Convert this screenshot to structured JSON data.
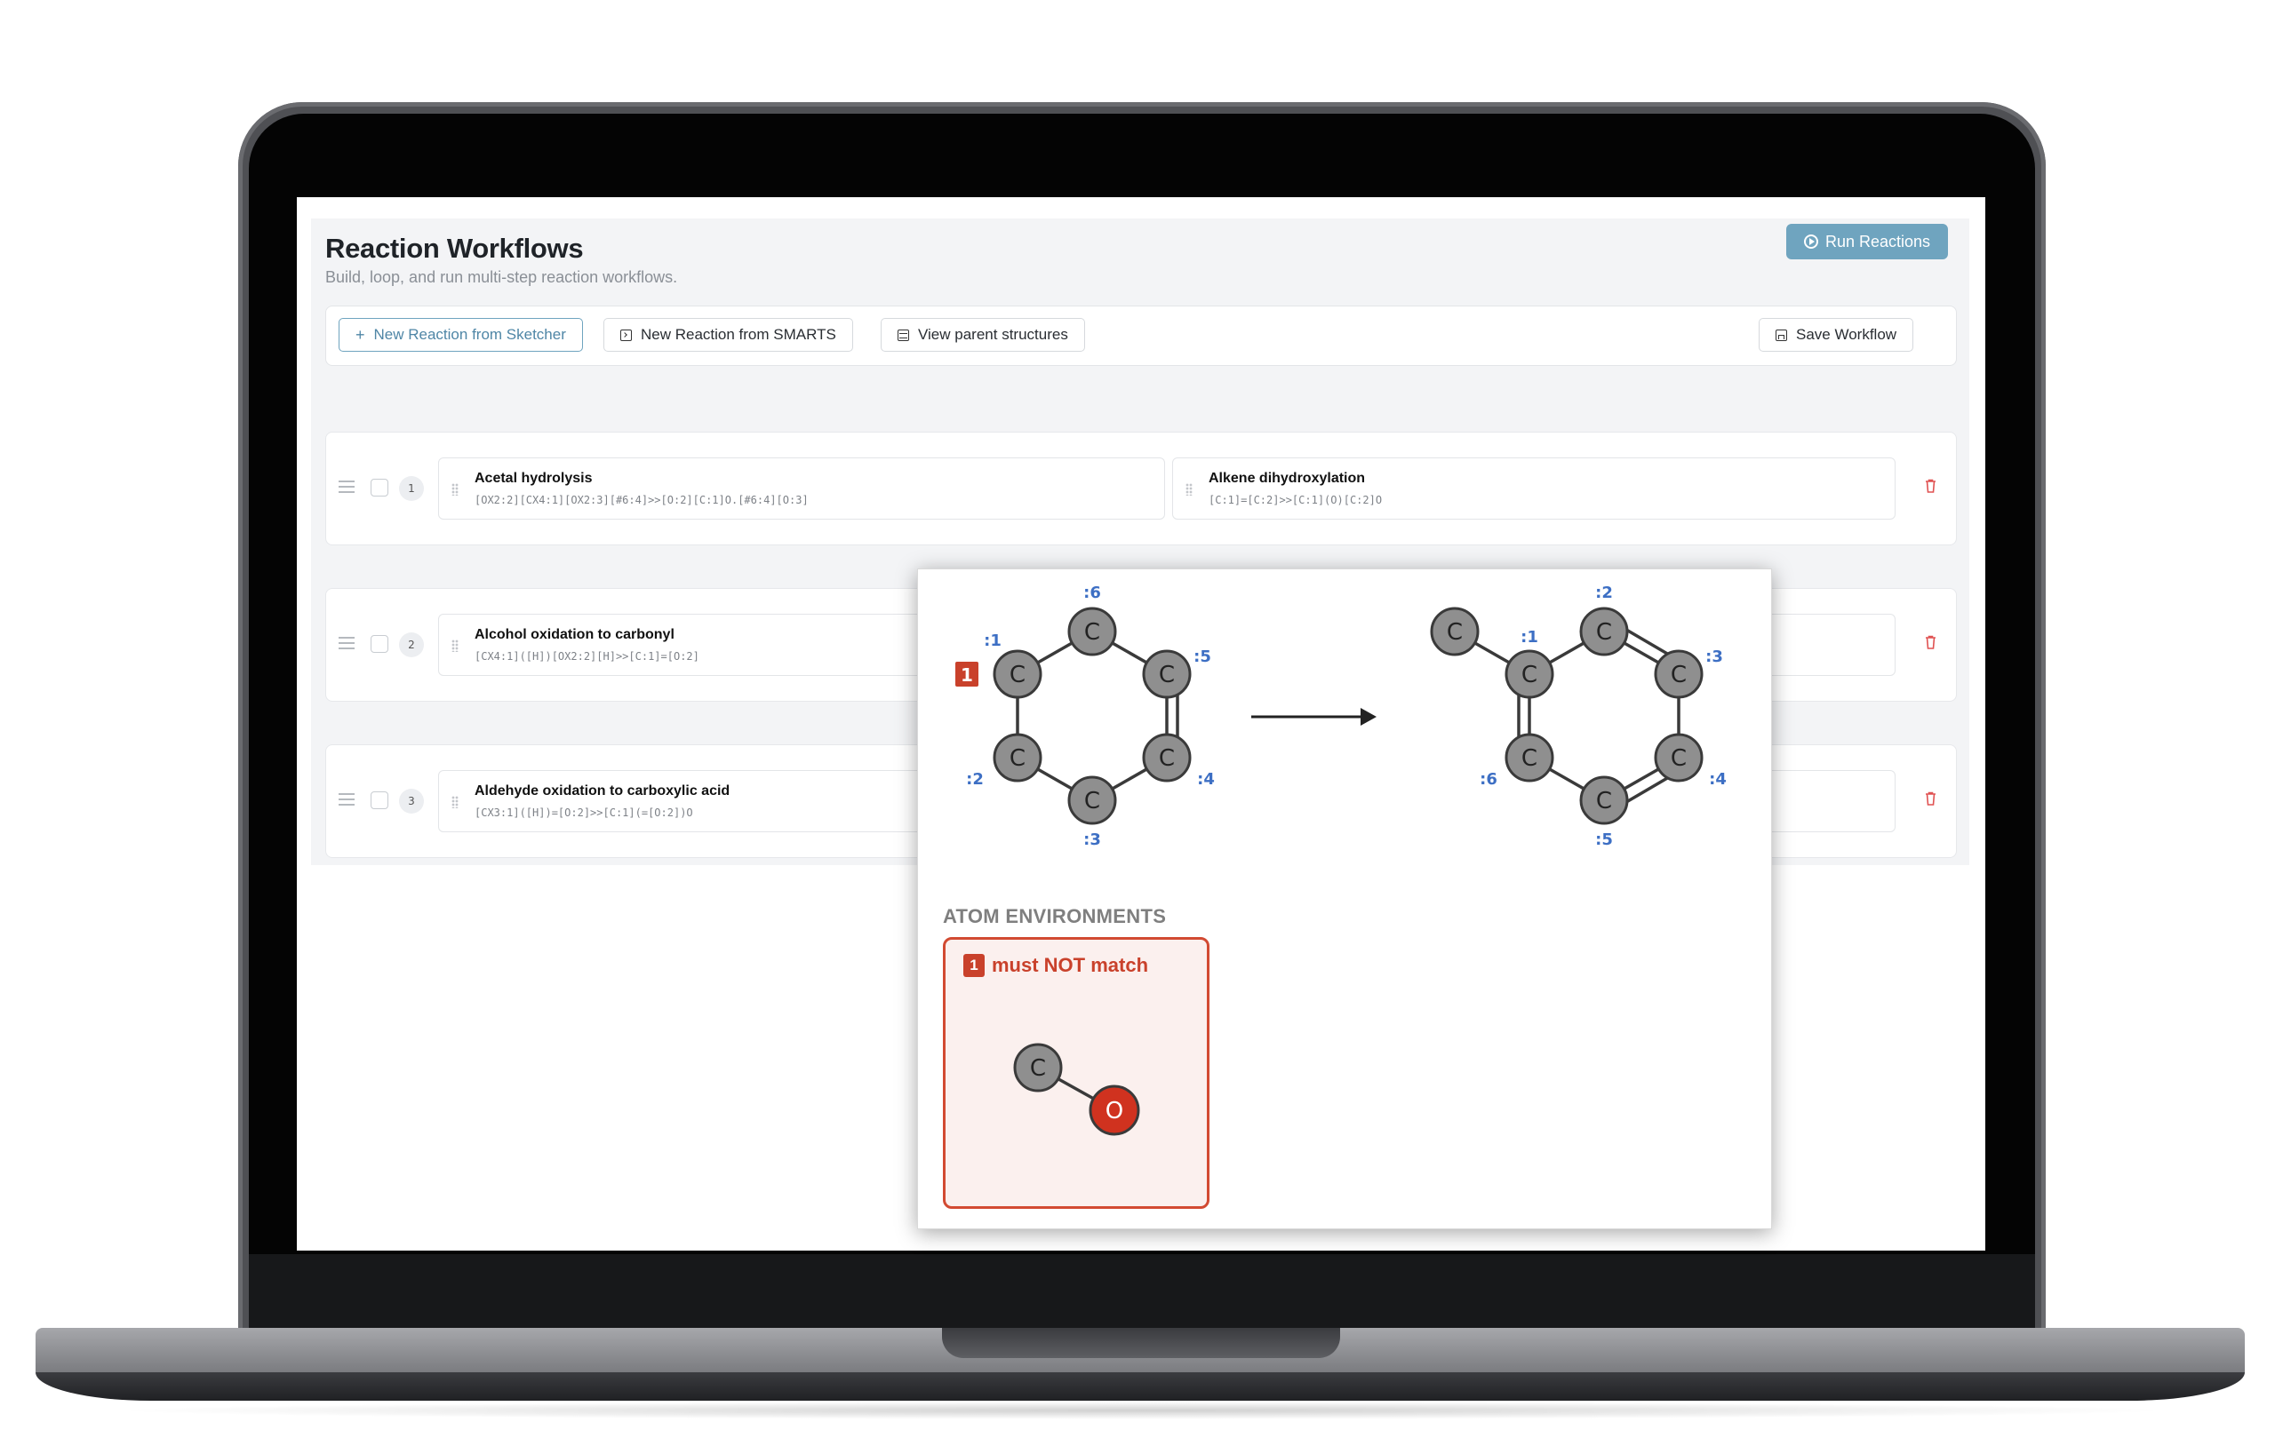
{
  "header": {
    "title": "Reaction Workflows",
    "subtitle": "Build, loop, and run multi-step reaction workflows.",
    "run_label": "Run Reactions"
  },
  "toolbar": {
    "new_sketcher_label": "New Reaction from Sketcher",
    "new_smarts_label": "New Reaction from SMARTS",
    "view_parent_label": "View parent structures",
    "save_label": "Save Workflow"
  },
  "rows": [
    {
      "number": "1",
      "reactions": [
        {
          "name": "Acetal hydrolysis",
          "smarts": "[OX2:2][CX4:1][OX2:3][#6:4]>>[O:2][C:1]O.[#6:4][O:3]"
        },
        {
          "name": "Alkene dihydroxylation",
          "smarts": "[C:1]=[C:2]>>[C:1](O)[C:2]O"
        }
      ]
    },
    {
      "number": "2",
      "reactions": [
        {
          "name": "Alcohol oxidation to carbonyl",
          "smarts": "[CX4:1]([H])[OX2:2][H]>>[C:1]=[O:2]"
        }
      ]
    },
    {
      "number": "3",
      "reactions": [
        {
          "name": "Aldehyde oxidation to carboxylic acid",
          "smarts": "[CX3:1]([H])=[O:2]>>[C:1](=[O:2])O"
        }
      ]
    }
  ],
  "popup": {
    "reactant_atoms": [
      {
        "symbol": "C",
        "map": ":6"
      },
      {
        "symbol": "C",
        "map": ":1",
        "marker": "1"
      },
      {
        "symbol": "C",
        "map": ":5"
      },
      {
        "symbol": "C",
        "map": ":2"
      },
      {
        "symbol": "C",
        "map": ":4"
      },
      {
        "symbol": "C",
        "map": ":3"
      }
    ],
    "product_atoms": [
      {
        "symbol": "C",
        "map": ""
      },
      {
        "symbol": "C",
        "map": ":1"
      },
      {
        "symbol": "C",
        "map": ":2"
      },
      {
        "symbol": "C",
        "map": ":3"
      },
      {
        "symbol": "C",
        "map": ":6"
      },
      {
        "symbol": "C",
        "map": ":4"
      },
      {
        "symbol": "C",
        "map": ":5"
      }
    ],
    "atom_environments_title": "ATOM ENVIRONMENTS",
    "environment": {
      "badge": "1",
      "label": "must NOT match",
      "atoms": [
        "C",
        "O"
      ]
    }
  },
  "colors": {
    "accent": "#6fa4bf",
    "danger": "#d24a32",
    "atom_carbon": "#8f8f8f",
    "atom_oxygen": "#d0321f",
    "map_label": "#3d6fc4"
  }
}
